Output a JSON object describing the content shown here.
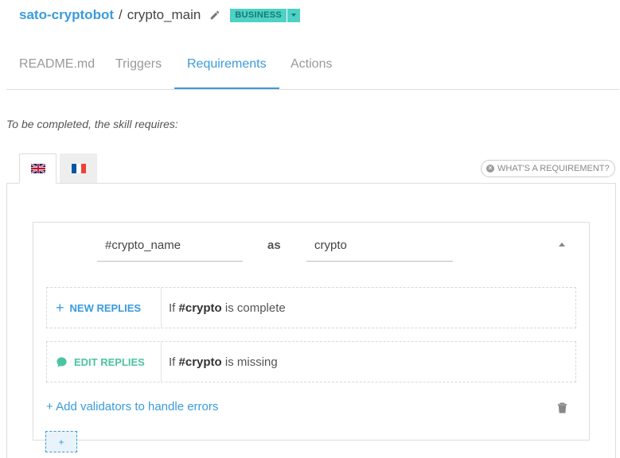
{
  "header": {
    "bot_name": "sato-cryptobot",
    "separator": "/",
    "skill_name": "crypto_main",
    "badge": "BUSINESS"
  },
  "tabs": [
    {
      "label": "README.md",
      "active": false
    },
    {
      "label": "Triggers",
      "active": false
    },
    {
      "label": "Requirements",
      "active": true
    },
    {
      "label": "Actions",
      "active": false
    }
  ],
  "intro": "To be completed, the skill requires:",
  "languages": [
    {
      "flag": "uk-flag-icon",
      "active": true
    },
    {
      "flag": "france-flag-icon",
      "active": false
    }
  ],
  "help_button": "WHAT'S A REQUIREMENT?",
  "requirement": {
    "entity": "#crypto_name",
    "as_label": "as",
    "alias": "crypto",
    "new_replies": {
      "label": "NEW REPLIES",
      "cond_prefix": "If ",
      "cond_var": "#crypto",
      "cond_suffix": " is complete"
    },
    "edit_replies": {
      "label": "EDIT REPLIES",
      "cond_prefix": "If ",
      "cond_var": "#crypto",
      "cond_suffix": " is missing"
    },
    "add_validators": "+ Add validators to handle errors"
  },
  "add_button": "+",
  "colors": {
    "accent": "#3a9bdc",
    "badge": "#4fd1c5",
    "edit_green": "#4cc3a2"
  }
}
